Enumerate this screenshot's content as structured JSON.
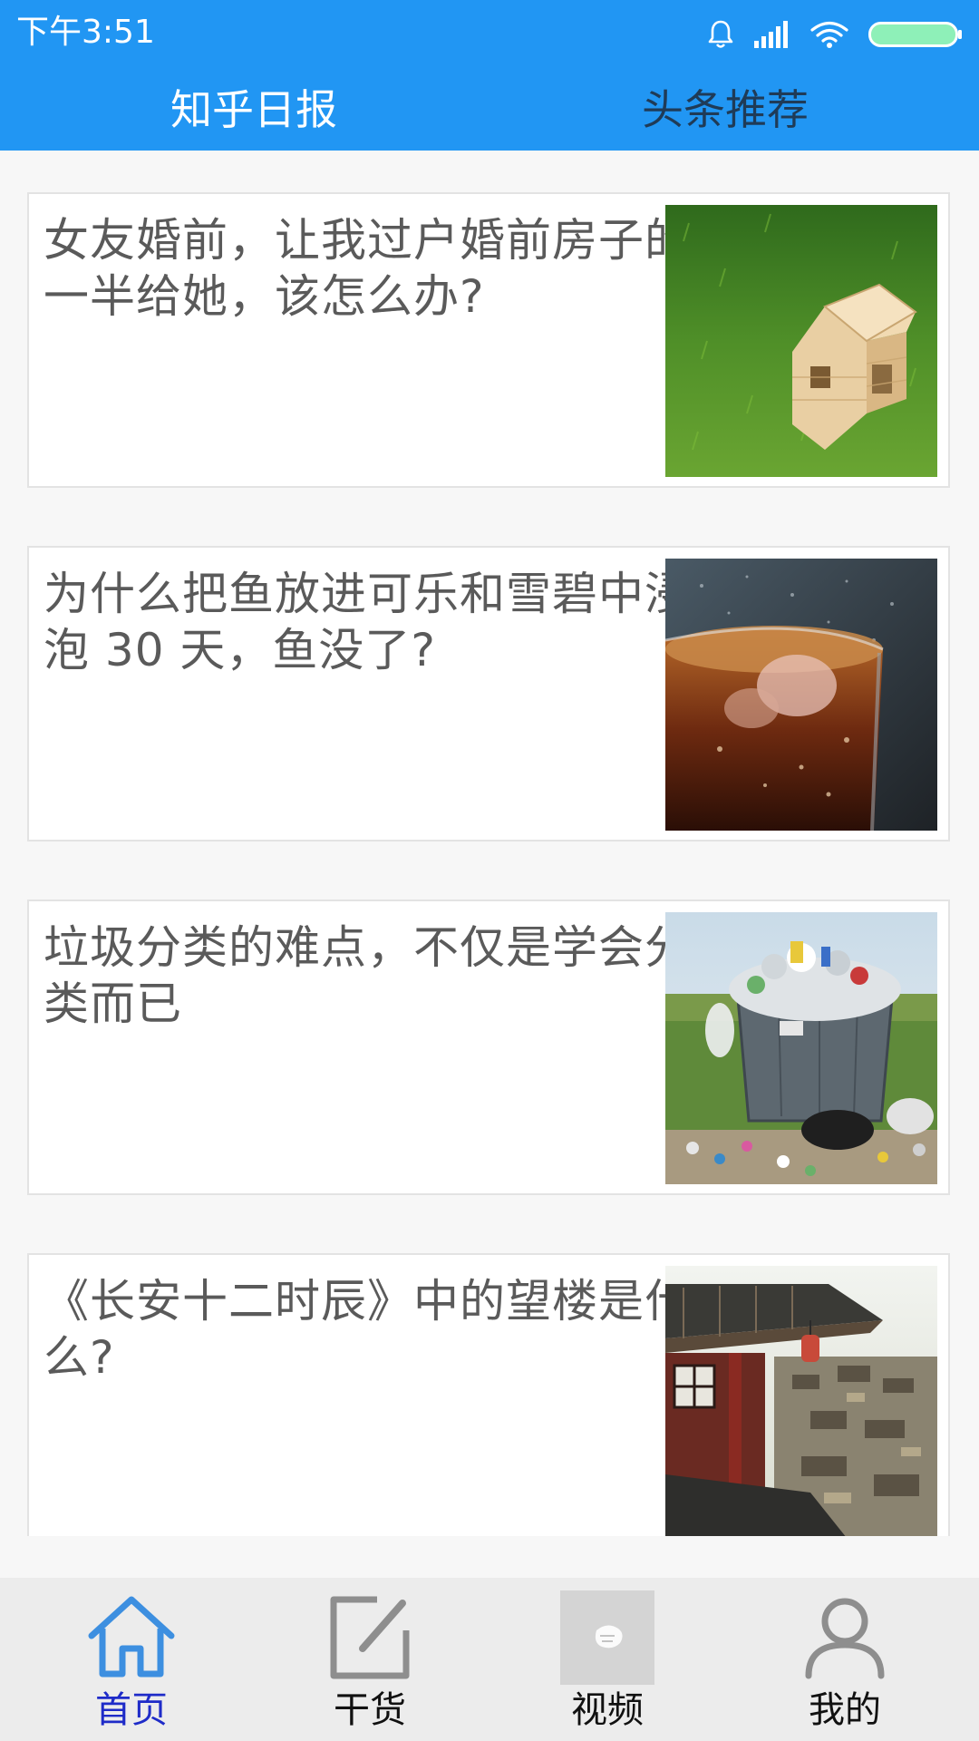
{
  "status_bar": {
    "time": "下午3:51",
    "icons": [
      "bell-icon",
      "signal-icon",
      "wifi-icon",
      "battery-icon"
    ]
  },
  "top_tabs": [
    {
      "label": "知乎日报",
      "active": true
    },
    {
      "label": "头条推荐",
      "active": false
    }
  ],
  "feed": [
    {
      "title": "女友婚前，让我过户婚前房子的一半给她，该怎么办?",
      "thumb": "wooden-house-on-grass"
    },
    {
      "title": "为什么把鱼放进可乐和雪碧中浸泡 30 天，鱼没了?",
      "thumb": "cola-glass-with-ice"
    },
    {
      "title": "垃圾分类的难点，不仅是学会分类而已",
      "thumb": "overflowing-trash-bin"
    },
    {
      "title": "《长安十二时辰》中的望楼是什么?",
      "thumb": "ancient-chinese-pavilion"
    }
  ],
  "bottom_nav": [
    {
      "label": "首页",
      "icon": "home-icon",
      "active": true
    },
    {
      "label": "干货",
      "icon": "edit-icon",
      "active": false
    },
    {
      "label": "视频",
      "icon": "video-thumbnail-icon",
      "active": false
    },
    {
      "label": "我的",
      "icon": "user-icon",
      "active": false
    }
  ],
  "colors": {
    "primary": "#2196f3",
    "active_tab_text": "#ffffff",
    "inactive_tab_text": "#1f3b57",
    "nav_active": "#1e2bc8",
    "battery": "#8ef0b8"
  }
}
